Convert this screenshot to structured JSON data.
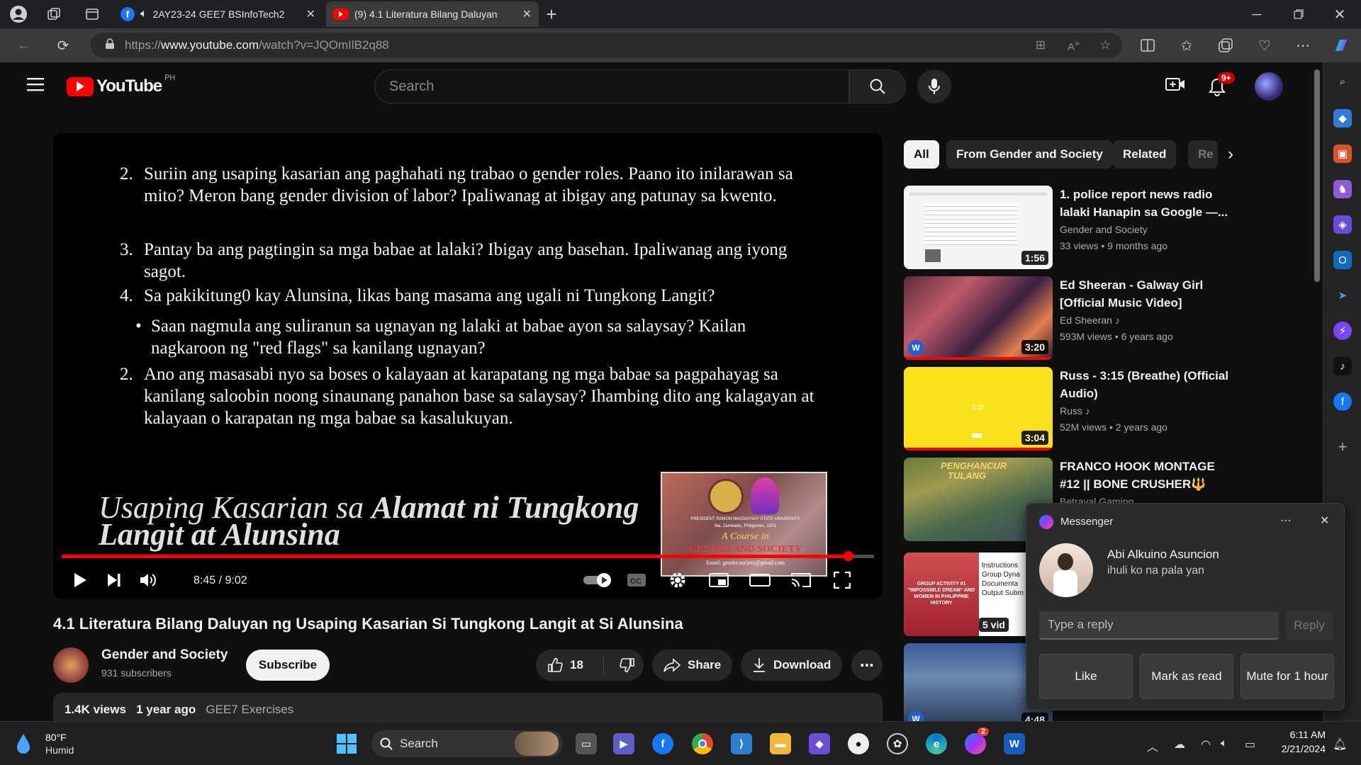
{
  "browser": {
    "tabs": [
      {
        "title": "2AY23-24 GEE7 BSInfoTech2",
        "close": "✕"
      },
      {
        "title": "(9) 4.1 Literatura Bilang Daluyan",
        "close": "✕"
      }
    ],
    "new_tab": "+",
    "url_prefix": "https://",
    "url_host": "www.youtube.com",
    "url_path": "/watch?v=JQOmIlB2q88"
  },
  "youtube": {
    "logo_text": "YouTube",
    "country": "PH",
    "search_placeholder": "Search",
    "notification_badge": "9+"
  },
  "player": {
    "slide_questions": [
      {
        "num": "2.",
        "text": "Suriin ang usaping kasarian ang paghahati ng trabao o gender roles. Paano ito inilarawan sa mito? Meron bang gender division of labor? Ipaliwanag at ibigay ang patunay sa kwento."
      },
      {
        "num": "3.",
        "text": " Pantay ba ang pagtingin sa mga babae at lalaki? Ibigay ang basehan. Ipaliwanag ang iyong sagot."
      },
      {
        "num": "4.",
        "text": "Sa pakikitung0 kay Alunsina, likas bang masama ang ugali ni Tungkong Langit?"
      },
      {
        "num": "•",
        "text": "Saan nagmula ang suliranun sa ugnayan ng lalaki at babae ayon sa salaysay? Kailan nagkaroon ng \"red flags\" sa kanilang ugnayan?"
      },
      {
        "num": "2.",
        "text": "Ano ang masasabi nyo sa boses o kalayaan at karapatang ng mga babae sa pagpahayag sa kanilang saloobin noong sinaunang panahon base sa salaysay? Ihambing dito ang kalagayan at kalayaan o karapatan ng mga babae sa kasalukuyan."
      }
    ],
    "slide_title_plain": "Usaping Kasarian sa ",
    "slide_title_bold": "Alamat ni Tungkong Langit at Alunsina",
    "logo_card": {
      "line1": "PRESIDENT RAMON MAGSAYSAY STATE UNIVERSITY",
      "line2": "Iba, Zambales, Philippines, 2201",
      "line3": "A Course in",
      "line4": "GENDER AND SOCIETY",
      "line5": "Email: gender.society@gmail.com"
    },
    "time": "8:45 / 9:02",
    "progress": 0.969
  },
  "video": {
    "title": "4.1 Literatura Bilang Daluyan ng Usaping Kasarian Si Tungkong Langit at Si Alunsina",
    "channel": "Gender and Society",
    "subscribers": "931 subscribers",
    "subscribe_label": "Subscribe",
    "likes": "18",
    "share_label": "Share",
    "download_label": "Download",
    "views": "1.4K views",
    "age": "1 year ago",
    "playlist_tag": "GEE7 Exercises"
  },
  "chips": [
    "All",
    "From Gender and Society",
    "Related",
    "Re"
  ],
  "recommendations": [
    {
      "title": "1. police report news radio lalaki Hanapin sa Google —...",
      "channel": "Gender and Society",
      "meta": "33 views • 9 months ago",
      "duration": "1:56",
      "music": false
    },
    {
      "title": "Ed Sheeran - Galway Girl [Official Music Video]",
      "channel": "Ed Sheeran",
      "meta": "593M views • 6 years ago",
      "duration": "3:20",
      "music": true
    },
    {
      "title": "Russ - 3:15 (Breathe) (Official Audio)",
      "channel": "Russ",
      "meta": "52M views • 2 years ago",
      "duration": "3:04",
      "music": true
    },
    {
      "title": "FRANCO HOOK MONTAGE #12 || BONE CRUSHER🔱",
      "channel": "Betrayal Gaming",
      "meta": "",
      "duration": "",
      "music": false
    },
    {
      "title": "",
      "channel": "",
      "meta": "",
      "duration": "5 vid",
      "music": false
    },
    {
      "title": "",
      "channel": "",
      "meta": "",
      "duration": "4:48",
      "music": false
    }
  ],
  "thumb_text": {
    "r3": "3:15",
    "r4a": "PENGHANCUR",
    "r4b": "TULANG",
    "r5a": "GROUP ACTIVITY #1 \"IMPOSSIBLE DREAM\" AND WOMEN IN PHILIPPINE HISTORY",
    "r5b": "Instructions Group Dyna Documenta Output Subm"
  },
  "messenger": {
    "app_name": "Messenger",
    "sender": "Abi Alkuino Asuncion",
    "message": "ihuli ko na pala yan",
    "reply_placeholder": "Type a reply",
    "reply_button": "Reply",
    "actions": [
      "Like",
      "Mark as read",
      "Mute for 1 hour"
    ]
  },
  "taskbar": {
    "weather_temp": "80°F",
    "weather_desc": "Humid",
    "search_label": "Search",
    "time": "6:11 AM",
    "date": "2/21/2024",
    "messenger_badge": "2"
  },
  "colors": {
    "accent_red": "#ff0000",
    "bg": "#0f0f0f",
    "chip_bg": "#272727"
  }
}
